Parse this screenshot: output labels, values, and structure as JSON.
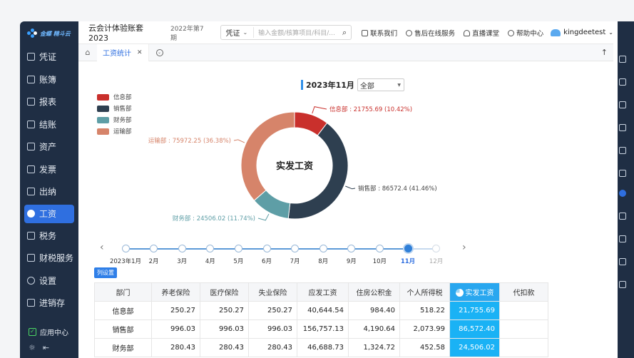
{
  "app": {
    "logo_text": "金蝶 精斗云",
    "account_title": "云会计体验账套2023",
    "period": "2022年第7期"
  },
  "sidebar": {
    "items": [
      {
        "label": "凭证",
        "icon": "voucher-icon"
      },
      {
        "label": "账簿",
        "icon": "ledger-icon"
      },
      {
        "label": "报表",
        "icon": "report-icon"
      },
      {
        "label": "结账",
        "icon": "closing-icon"
      },
      {
        "label": "资产",
        "icon": "asset-icon"
      },
      {
        "label": "发票",
        "icon": "invoice-icon"
      },
      {
        "label": "出纳",
        "icon": "cashier-icon"
      },
      {
        "label": "工资",
        "icon": "salary-icon",
        "active": true
      },
      {
        "label": "税务",
        "icon": "tax-icon"
      },
      {
        "label": "财税服务",
        "icon": "service-icon"
      },
      {
        "label": "设置",
        "icon": "settings-icon"
      },
      {
        "label": "进销存",
        "icon": "inventory-icon"
      }
    ],
    "app_center": "应用中心"
  },
  "topbar": {
    "search_type": "凭证",
    "search_placeholder": "输入金额/核算项目/科目/...",
    "links": [
      "联系我们",
      "售后在线服务",
      "直播课堂",
      "帮助中心"
    ],
    "user": "kingdeetest"
  },
  "tabs": {
    "active_label": "工资统计"
  },
  "filter": {
    "period_label": "2023年11月",
    "dept_value": "全部"
  },
  "chart_data": {
    "type": "pie",
    "title": "",
    "center_label": "实发工资",
    "legend_position": "top-left",
    "slices": [
      {
        "name": "信息部",
        "value": 21755.69,
        "percent": 10.42,
        "label": "信息部 : 21755.69 (10.42%)",
        "color": "#c9302c"
      },
      {
        "name": "销售部",
        "value": 86572.4,
        "percent": 41.46,
        "label": "销售部 : 86572.4 (41.46%)",
        "color": "#2e3f50"
      },
      {
        "name": "财务部",
        "value": 24506.02,
        "percent": 11.74,
        "label": "财务部 : 24506.02 (11.74%)",
        "color": "#5e9ea6"
      },
      {
        "name": "运输部",
        "value": 75972.25,
        "percent": 36.38,
        "label": "运输部 : 75972.25 (36.38%)",
        "color": "#d6846a"
      }
    ]
  },
  "timeline": {
    "labels": [
      "2023年1月",
      "2月",
      "3月",
      "4月",
      "5月",
      "6月",
      "7月",
      "8月",
      "9月",
      "10月",
      "11月",
      "12月"
    ],
    "current_index": 10
  },
  "table": {
    "column_settings_label": "列设置",
    "headers": [
      "部门",
      "养老保险",
      "医疗保险",
      "失业保险",
      "应发工资",
      "住房公积金",
      "个人所得税",
      "实发工资",
      "代扣款"
    ],
    "rows": [
      [
        "信息部",
        "250.27",
        "250.27",
        "250.27",
        "40,644.54",
        "984.40",
        "518.22",
        "21,755.69",
        ""
      ],
      [
        "销售部",
        "996.03",
        "996.03",
        "996.03",
        "156,757.13",
        "4,190.64",
        "2,073.99",
        "86,572.40",
        ""
      ],
      [
        "财务部",
        "280.43",
        "280.43",
        "280.43",
        "46,688.73",
        "1,324.72",
        "452.58",
        "24,506.02",
        ""
      ]
    ]
  }
}
